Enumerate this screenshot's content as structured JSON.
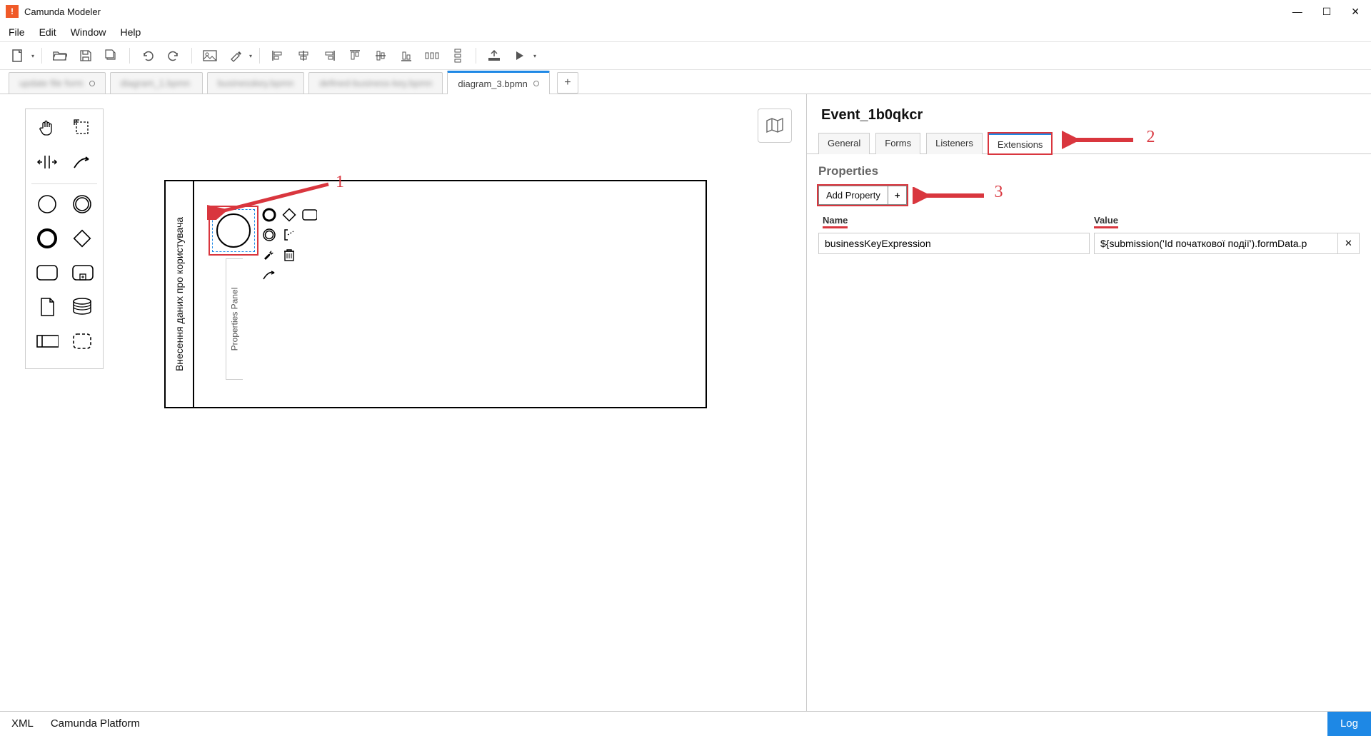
{
  "app": {
    "title": "Camunda Modeler",
    "icon_letter": "!"
  },
  "menu": {
    "file": "File",
    "edit": "Edit",
    "window": "Window",
    "help": "Help"
  },
  "tabs": {
    "items": [
      {
        "label": "update file form"
      },
      {
        "label": "diagram_1.bpmn"
      },
      {
        "label": "businesskey.bpmn"
      },
      {
        "label": "defined-business-key.bpmn"
      }
    ],
    "active": {
      "label": "diagram_3.bpmn"
    },
    "add": "+"
  },
  "pool": {
    "lane_label": "Внесення даних про користувача"
  },
  "minimap": {
    "tooltip": "Toggle minimap"
  },
  "props_handle": "Properties Panel",
  "panel": {
    "element_id": "Event_1b0qkcr",
    "tabs": {
      "general": "General",
      "forms": "Forms",
      "listeners": "Listeners",
      "extensions": "Extensions"
    },
    "section_title": "Properties",
    "add_property": "Add Property",
    "headers": {
      "name": "Name",
      "value": "Value"
    },
    "rows": [
      {
        "name": "businessKeyExpression",
        "value": "${submission('Id початкової події').formData.p"
      }
    ]
  },
  "annotations": {
    "n1": "1",
    "n2": "2",
    "n3": "3"
  },
  "status": {
    "xml": "XML",
    "platform": "Camunda Platform",
    "log": "Log"
  }
}
